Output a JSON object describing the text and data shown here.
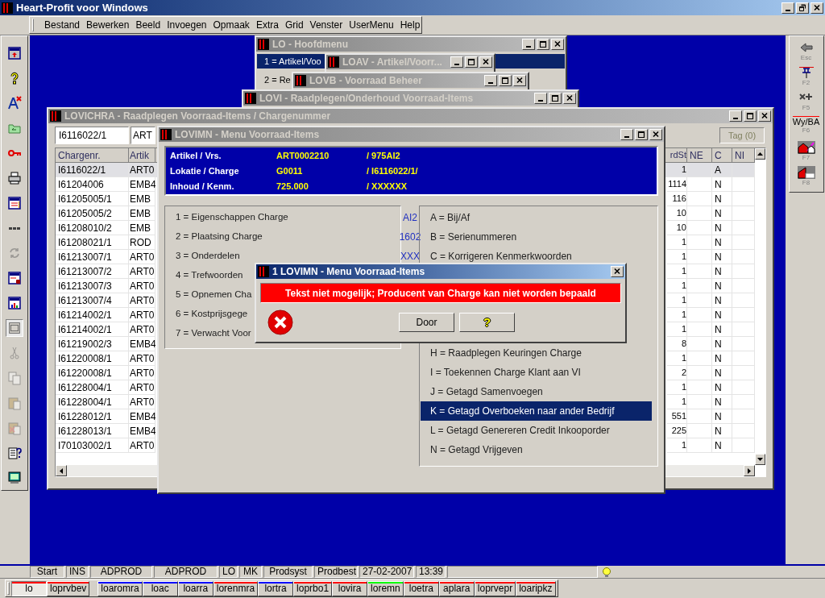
{
  "app": {
    "title": "Heart-Profit voor Windows"
  },
  "menu": [
    "Bestand",
    "Bewerken",
    "Beeld",
    "Invoegen",
    "Opmaak",
    "Extra",
    "Grid",
    "Venster",
    "UserMenu",
    "Help"
  ],
  "left_toolbar": [
    {
      "kind": "window-arrow",
      "disabled": false,
      "pressed": false
    },
    {
      "kind": "help",
      "disabled": false,
      "pressed": false
    },
    {
      "kind": "font-delete",
      "disabled": false,
      "pressed": false
    },
    {
      "kind": "folder",
      "disabled": false,
      "pressed": false
    },
    {
      "kind": "key",
      "disabled": false,
      "pressed": false
    },
    {
      "kind": "printer",
      "disabled": false,
      "pressed": false
    },
    {
      "kind": "window",
      "disabled": false,
      "pressed": false
    },
    {
      "kind": "dots",
      "disabled": false,
      "pressed": false
    },
    {
      "kind": "refresh",
      "disabled": true,
      "pressed": false
    },
    {
      "kind": "form",
      "disabled": false,
      "pressed": false
    },
    {
      "kind": "chart",
      "disabled": false,
      "pressed": false
    },
    {
      "kind": "frame",
      "disabled": false,
      "pressed": true
    },
    {
      "kind": "scissors",
      "disabled": true,
      "pressed": false
    },
    {
      "kind": "copy",
      "disabled": true,
      "pressed": false
    },
    {
      "kind": "paste",
      "disabled": true,
      "pressed": false
    },
    {
      "kind": "paste-delete",
      "disabled": true,
      "pressed": false
    },
    {
      "kind": "properties",
      "disabled": false,
      "pressed": false
    },
    {
      "kind": "monitor",
      "disabled": false,
      "pressed": false
    }
  ],
  "right_toolbar": [
    {
      "kind": "back",
      "key": "Esc"
    },
    {
      "kind": "pin",
      "key": "F2"
    },
    {
      "kind": "cross",
      "key": "F5"
    },
    {
      "kind": "caption",
      "caption": "Wy/BA",
      "key": "F6"
    },
    {
      "kind": "house-edit",
      "key": "F7"
    },
    {
      "kind": "house",
      "key": "F8"
    }
  ],
  "windows": [
    {
      "kind": "menu",
      "title": "LO - Hoofdmenu",
      "active": false,
      "items": [
        {
          "text": "1 = Artikel/Voo",
          "selected": true
        },
        {
          "text": "2 = Re",
          "selected": false
        }
      ]
    },
    {
      "kind": "stub",
      "title": "LOAV - Artikel/Voorr...",
      "active": false
    },
    {
      "kind": "stub",
      "title": "LOVB - Voorraad Beheer",
      "active": false
    },
    {
      "kind": "stub",
      "title": "LOVI - Raadplegen/Onderhoud Voorraad-Items",
      "active": false
    },
    {
      "kind": "grid",
      "title": "LOVICHRA - Raadplegen Voorraad-Items / Chargenummer",
      "active": false,
      "fields": [
        "I6116022/1",
        "ART"
      ],
      "tag_button": "Tag (0)",
      "columns": {
        "chargenr": "Chargenr.",
        "artik": "Artik",
        "rdst": "rdSt",
        "ne": "NE",
        "c": "C",
        "ni": "NI"
      },
      "rows": [
        {
          "chargenr": "I6116022/1",
          "artik": "ART0",
          "rdst": "1",
          "c": "A",
          "selected": true
        },
        {
          "chargenr": "I61204006",
          "artik": "EMB4",
          "rdst": "1114",
          "c": "N",
          "selected": false
        },
        {
          "chargenr": "I61205005/1",
          "artik": "EMB",
          "rdst": "116",
          "c": "N",
          "selected": false
        },
        {
          "chargenr": "I61205005/2",
          "artik": "EMB",
          "rdst": "10",
          "c": "N",
          "selected": false
        },
        {
          "chargenr": "I61208010/2",
          "artik": "EMB",
          "rdst": "10",
          "c": "N",
          "selected": false
        },
        {
          "chargenr": "I61208021/1",
          "artik": "ROD",
          "rdst": "1",
          "c": "N",
          "selected": false
        },
        {
          "chargenr": "I61213007/1",
          "artik": "ART0",
          "rdst": "1",
          "c": "N",
          "selected": false
        },
        {
          "chargenr": "I61213007/2",
          "artik": "ART0",
          "rdst": "1",
          "c": "N",
          "selected": false
        },
        {
          "chargenr": "I61213007/3",
          "artik": "ART0",
          "rdst": "1",
          "c": "N",
          "selected": false
        },
        {
          "chargenr": "I61213007/4",
          "artik": "ART0",
          "rdst": "1",
          "c": "N",
          "selected": false
        },
        {
          "chargenr": "I61214002/1",
          "artik": "ART0",
          "rdst": "1",
          "c": "N",
          "selected": false
        },
        {
          "chargenr": "I61214002/1",
          "artik": "ART0",
          "rdst": "1",
          "c": "N",
          "selected": false
        },
        {
          "chargenr": "I61219002/3",
          "artik": "EMB4",
          "rdst": "8",
          "c": "N",
          "selected": false
        },
        {
          "chargenr": "I61220008/1",
          "artik": "ART0",
          "rdst": "1",
          "c": "N",
          "selected": false
        },
        {
          "chargenr": "I61220008/1",
          "artik": "ART0",
          "rdst": "2",
          "c": "N",
          "selected": false
        },
        {
          "chargenr": "I61228004/1",
          "artik": "ART0",
          "rdst": "1",
          "c": "N",
          "selected": false
        },
        {
          "chargenr": "I61228004/1",
          "artik": "ART0",
          "rdst": "1",
          "c": "N",
          "selected": false
        },
        {
          "chargenr": "I61228012/1",
          "artik": "EMB4",
          "rdst": "551",
          "c": "N",
          "selected": false
        },
        {
          "chargenr": "I61228013/1",
          "artik": "EMB4",
          "rdst": "225",
          "c": "N",
          "selected": false
        },
        {
          "chargenr": "I70103002/1",
          "artik": "ART0",
          "rdst": "1",
          "c": "N",
          "selected": false
        }
      ]
    },
    {
      "kind": "item-menu",
      "title": "LOVIMN - Menu Voorraad-Items",
      "active": false,
      "header": [
        {
          "label": "Artikel / Vrs.",
          "value": "ART0002210",
          "extra": "/ 975AI2"
        },
        {
          "label": "Lokatie / Charge",
          "value": "G0011",
          "extra": "/ I6116022/1/"
        },
        {
          "label": "Inhoud  / Kenm.",
          "value": "725.000",
          "extra": "/ XXXXXX"
        }
      ],
      "left_items": [
        {
          "text": "1 = Eigenschappen Charge",
          "selected": false
        },
        {
          "text": "2 = Plaatsing     Charge",
          "selected": false
        },
        {
          "text": "3 = Onderdelen",
          "selected": false
        },
        {
          "text": "4 = Trefwoorden",
          "selected": false
        },
        {
          "text": "5 = Opnemen Cha",
          "selected": false
        },
        {
          "text": "6 = Kostprijsgege",
          "selected": false
        },
        {
          "text": "7 = Verwacht Voor",
          "selected": false
        }
      ],
      "between_texts": [
        "AI2",
        "1602",
        "XXX"
      ],
      "right_items": [
        {
          "text": "A = Bij/Af",
          "selected": false
        },
        {
          "text": "B = Serienummeren",
          "selected": false
        },
        {
          "text": "C = Korrigeren Kenmerkwoorden",
          "selected": false
        },
        {
          "text": "H = Raadplegen Keuringen Charge",
          "selected": false
        },
        {
          "text": "I = Toekennen Charge Klant aan VI",
          "selected": false
        },
        {
          "text": "J  = Getagd Samenvoegen",
          "selected": false
        },
        {
          "text": "K = Getagd Overboeken naar ander Bedrijf",
          "selected": true
        },
        {
          "text": "L = Getagd Genereren Credit Inkooporder",
          "selected": false
        },
        {
          "text": "N = Getagd Vrijgeven",
          "selected": false
        }
      ]
    },
    {
      "kind": "dialog",
      "title": "1 LOVIMN - Menu Voorraad-Items",
      "active": true,
      "message": "Tekst niet mogelijk; Producent van Charge kan niet worden bepaald",
      "ok_button": "Door",
      "help_button": "?"
    }
  ],
  "status_bar": [
    "Start",
    "INS",
    "ADPROD",
    "ADPROD",
    "LO",
    "MK",
    "Prodsyst",
    "Prodbest",
    "27-02-2007",
    "13:39"
  ],
  "taskbar": [
    {
      "label": "lo",
      "color": "#ff0000",
      "selected": true
    },
    {
      "label": "loprvbev",
      "color": "#ff0000",
      "selected": false
    },
    {
      "label": "loaromra",
      "color": "#0000ff",
      "selected": false
    },
    {
      "label": "loac",
      "color": "#0000ff",
      "selected": false
    },
    {
      "label": "loarra",
      "color": "#0000ff",
      "selected": false
    },
    {
      "label": "lorenmra",
      "color": "#ff0000",
      "selected": false
    },
    {
      "label": "lortra",
      "color": "#0000ff",
      "selected": false
    },
    {
      "label": "loprbo1",
      "color": "#ff0000",
      "selected": false
    },
    {
      "label": "lovira",
      "color": "#ff0000",
      "selected": false
    },
    {
      "label": "loremn",
      "color": "#00ff00",
      "selected": false
    },
    {
      "label": "loetra",
      "color": "#ff0000",
      "selected": false
    },
    {
      "label": "aplara",
      "color": "#ff0000",
      "selected": false
    },
    {
      "label": "loprvepr",
      "color": "#ff0000",
      "selected": false
    },
    {
      "label": "loaripkz",
      "color": "#ff0000",
      "selected": false
    }
  ]
}
